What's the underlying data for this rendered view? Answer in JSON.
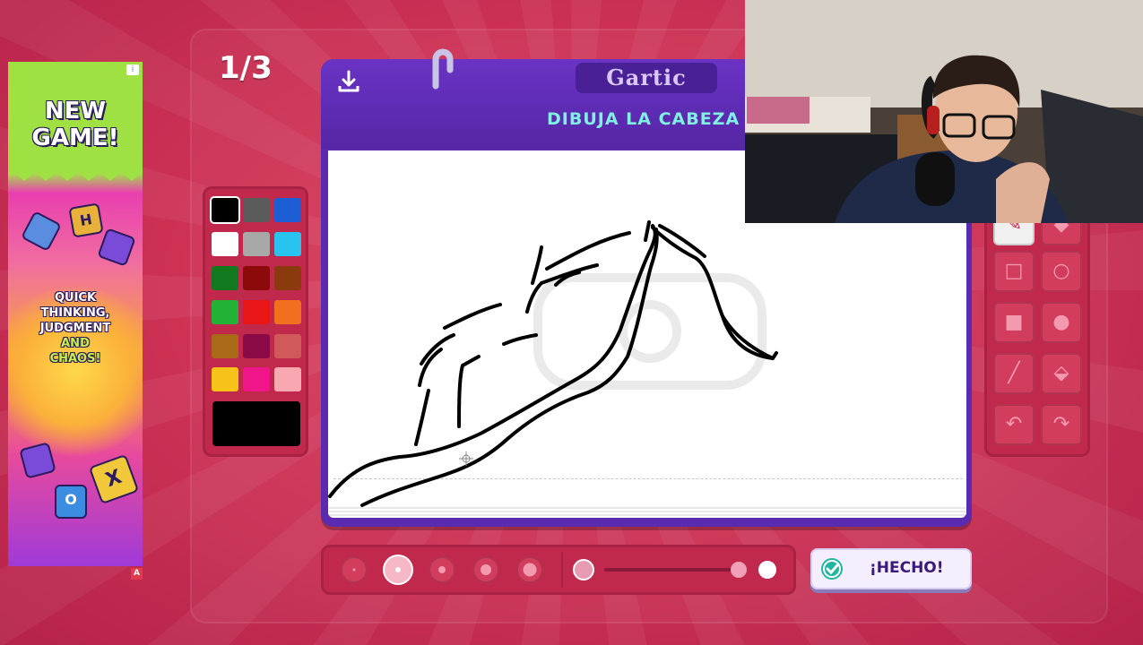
{
  "round_counter": "1/3",
  "ad": {
    "title_line1": "NEW",
    "title_line2": "GAME!",
    "tagline_line1": "QUICK",
    "tagline_line2": "THINKING,",
    "tagline_line3": "JUDGMENT",
    "tagline_line4": "AND",
    "tagline_line5": "CHAOS!",
    "tiles": [
      "H",
      "X",
      "O"
    ],
    "adchoices_label": "A"
  },
  "card": {
    "logo_text": "Gartic",
    "prompt": "DIBUJA LA CABEZA",
    "download_icon": "download-icon"
  },
  "palette": {
    "colors": [
      "#000000",
      "#5a5a5a",
      "#1e5ed4",
      "#ffffff",
      "#a8a8a8",
      "#29c3f0",
      "#117a1f",
      "#8c0a0a",
      "#8a3a0c",
      "#22b336",
      "#e81616",
      "#f07020",
      "#a86a18",
      "#8a0a48",
      "#d05a5a",
      "#f7c21a",
      "#f0168a",
      "#f7a8b0"
    ],
    "selected_color": "#000000",
    "current_color": "#000000"
  },
  "tools": [
    "pen-icon",
    "eraser-icon",
    "rectangle-outline-icon",
    "circle-outline-icon",
    "rectangle-filled-icon",
    "circle-filled-icon",
    "line-icon",
    "fill-bucket-icon",
    "undo-icon",
    "redo-icon"
  ],
  "selected_tool": "pen-icon",
  "brush_sizes": {
    "options": 5,
    "selected_index": 1
  },
  "opacity": {
    "value": 1.0
  },
  "done_button": {
    "label": "¡HECHO!"
  },
  "colors": {
    "accent_purple": "#5a2bb0",
    "background": "#cf3356",
    "prompt_text": "#7ff0e2"
  }
}
